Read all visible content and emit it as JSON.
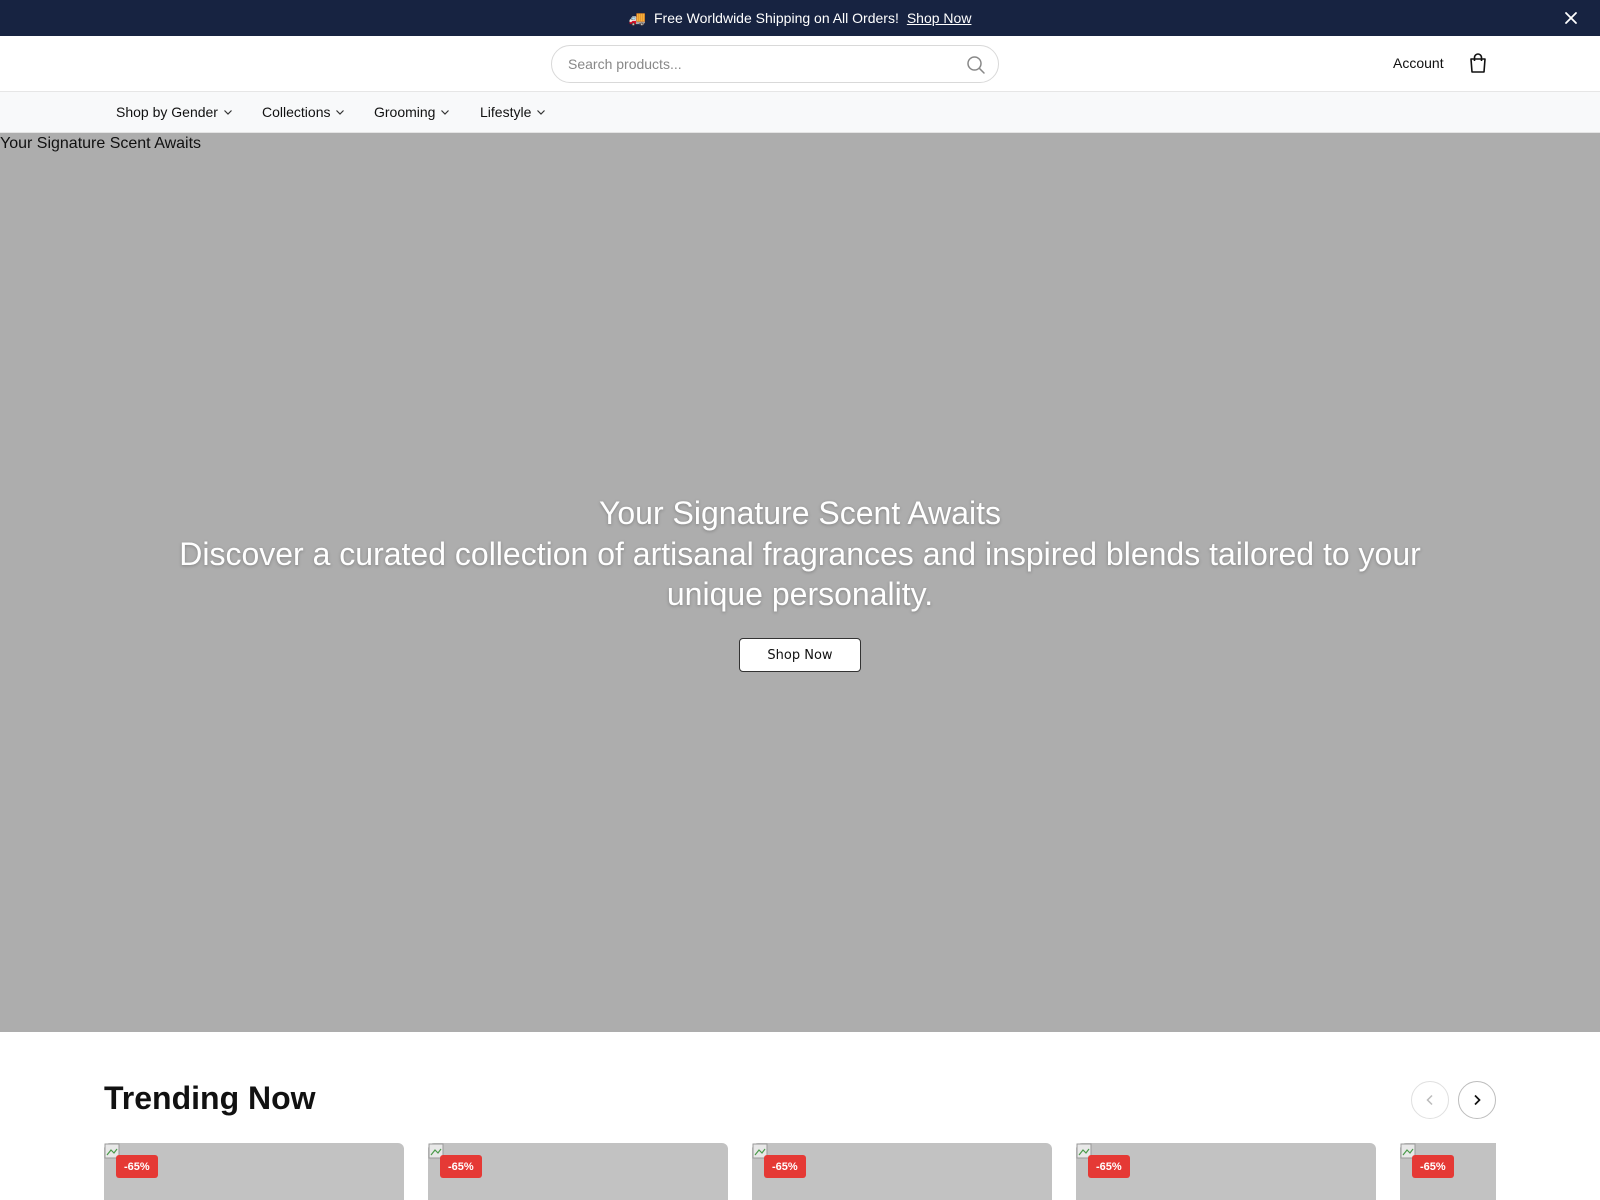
{
  "announcement": {
    "truck_icon": "🚚",
    "text": "Free Worldwide Shipping on All Orders!",
    "link": "Shop Now"
  },
  "header": {
    "search_placeholder": "Search products...",
    "account": "Account"
  },
  "nav": {
    "items": [
      {
        "label": "Shop by Gender"
      },
      {
        "label": "Collections"
      },
      {
        "label": "Grooming"
      },
      {
        "label": "Lifestyle"
      }
    ]
  },
  "hero": {
    "image_alt": "Your Signature Scent Awaits",
    "title": "Your Signature Scent Awaits",
    "subtitle": "Discover a curated collection of artisanal fragrances and inspired blends tailored to your unique personality.",
    "cta": "Shop Now",
    "background": "#adadad"
  },
  "trending": {
    "title": "Trending Now",
    "cards": [
      {
        "badge": "-65%"
      },
      {
        "badge": "-65%"
      },
      {
        "badge": "-65%"
      },
      {
        "badge": "-65%"
      },
      {
        "badge": "-65%"
      }
    ]
  },
  "colors": {
    "announce_bg": "#172341",
    "badge": "#e53935"
  }
}
